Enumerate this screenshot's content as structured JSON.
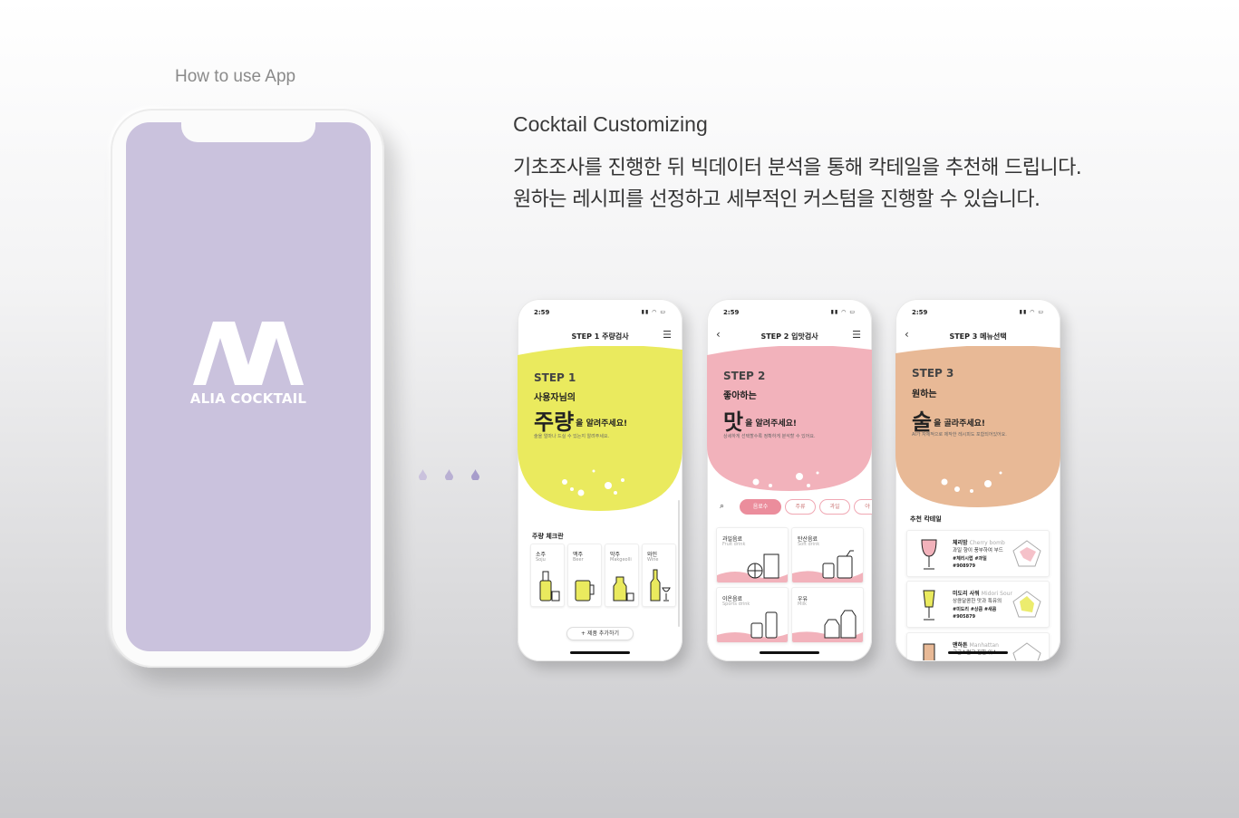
{
  "header": {
    "how_to": "How to use App"
  },
  "intro": {
    "title": "Cocktail Customizing",
    "desc_line1": "기초조사를 진행한 뒤 빅데이터 분석을 통해 칵테일을 추천해 드립니다.",
    "desc_line2": "원하는 레시피를 선정하고 세부적인 커스텀을 진행할 수 있습니다."
  },
  "splash": {
    "logo_text": "ALIA COCKTAIL",
    "bg_color": "#cac2dd"
  },
  "phone1": {
    "time": "2:59",
    "nav_title": "STEP 1 주량검사",
    "step": "STEP 1",
    "line1": "사용자님의",
    "big": "주량",
    "line2_rest": "을 알려주세요!",
    "hint": "술을 얼마나 드실 수 있는지 알려주세요.",
    "section": "주량 체크란",
    "drinks": [
      {
        "ko": "소주",
        "en": "Soju"
      },
      {
        "ko": "맥주",
        "en": "Beer"
      },
      {
        "ko": "막주",
        "en": "Makgeolli"
      },
      {
        "ko": "와인",
        "en": "Wine"
      }
    ],
    "add_button": "+ 제품 추가하기",
    "accent": "#eaea5e"
  },
  "phone2": {
    "time": "2:59",
    "nav_title": "STEP 2 입맛검사",
    "step": "STEP 2",
    "line1": "좋아하는",
    "big": "맛",
    "line2_rest": "을 알려주세요!",
    "hint": "상세하게 선택할수록 정확하게 분석할 수 있어요.",
    "chips": [
      "음료수",
      "주류",
      "과일",
      "야"
    ],
    "cards": [
      {
        "ko": "과일음료",
        "en": "Fruit drink"
      },
      {
        "ko": "탄산음료",
        "en": "Soft drink"
      },
      {
        "ko": "이온음료",
        "en": "Sports drink"
      },
      {
        "ko": "우유",
        "en": "Milk"
      }
    ],
    "accent": "#f2b2bb"
  },
  "phone3": {
    "time": "2:59",
    "nav_title": "STEP 3 메뉴선택",
    "step": "STEP 3",
    "line1": "원하는",
    "big": "술",
    "line2_rest": "을 골라주세요!",
    "hint": "AI가 자체적으로 제작한 레시피도 포함되어있어요.",
    "section": "추천 칵테일",
    "recs": [
      {
        "name": "체리밤",
        "en": "Cherry bomb",
        "desc": "과일 향이 풍부하여 부드",
        "tags": "#체리시럽 #과일",
        "code": "#908979"
      },
      {
        "name": "미도리 사워",
        "en": "Midori Sour",
        "desc": "상큼달콤한 맛과 특유의",
        "tags": "#미도리 #상큼 #새콤",
        "code": "#905879"
      },
      {
        "name": "맨하튼",
        "en": "Manhattan",
        "desc": "고급스럽고 진한 위스",
        "tags": "",
        "code": ""
      }
    ],
    "accent": "#e8b996"
  }
}
